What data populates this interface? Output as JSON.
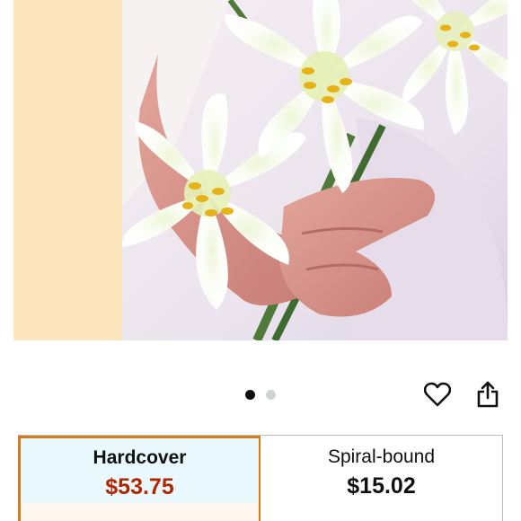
{
  "product_image": {
    "alt": "",
    "carousel": {
      "count": 2,
      "active_index": 0
    }
  },
  "actions": {
    "wishlist_icon": "heart-outline-icon",
    "share_icon": "share-icon"
  },
  "formats": [
    {
      "name": "Hardcover",
      "price": "$53.75",
      "selected": true
    },
    {
      "name": "Spiral-bound",
      "price": "$15.02",
      "selected": false
    }
  ],
  "colors": {
    "selected_border": "#d47b1e",
    "selected_bg": "#eaf9fd",
    "price_red": "#b12704",
    "text": "#0f1111",
    "cover_stripe": "#fde6bd"
  }
}
